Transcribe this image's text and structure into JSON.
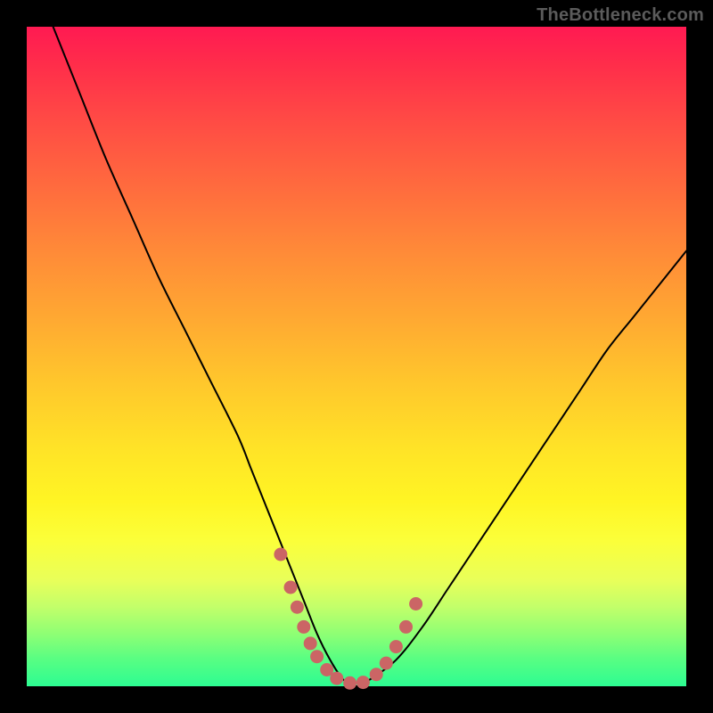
{
  "watermark": "TheBottleneck.com",
  "colors": {
    "frame_background": "#000000",
    "watermark_text": "#5b5b5b",
    "curve_stroke": "#000000",
    "marker_fill": "#cb6565",
    "gradient_stops": [
      "#ff1a52",
      "#ff2e4a",
      "#ff4a45",
      "#ff6a3e",
      "#ff8a38",
      "#ffa832",
      "#ffc72c",
      "#ffe327",
      "#fff524",
      "#fbff3a",
      "#e8ff5a",
      "#c2ff6a",
      "#8fff74",
      "#57fe83",
      "#2dfc92"
    ]
  },
  "chart_data": {
    "type": "line",
    "title": "",
    "xlabel": "",
    "ylabel": "",
    "xlim": [
      0,
      100
    ],
    "ylim": [
      0,
      100
    ],
    "note": "x is normalized horizontal position (0-100 left→right); y is normalized penalty metric (0 at bottom = optimal / green, 100 at top = worst / red). No axis ticks or numeric labels are rendered.",
    "series": [
      {
        "name": "bottleneck-curve",
        "x": [
          0,
          4,
          8,
          12,
          16,
          20,
          24,
          28,
          32,
          34,
          36,
          38,
          40,
          42,
          44,
          46,
          48,
          50,
          52,
          56,
          60,
          64,
          68,
          72,
          76,
          80,
          84,
          88,
          92,
          96,
          100
        ],
        "y": [
          110,
          100,
          90,
          80,
          71,
          62,
          54,
          46,
          38,
          33,
          28,
          23,
          18,
          13,
          8,
          4,
          1,
          0,
          1,
          4,
          9,
          15,
          21,
          27,
          33,
          39,
          45,
          51,
          56,
          61,
          66
        ]
      }
    ],
    "markers": {
      "name": "highlight-dots",
      "points": [
        {
          "x": 38.5,
          "y": 20
        },
        {
          "x": 40,
          "y": 15
        },
        {
          "x": 41,
          "y": 12
        },
        {
          "x": 42,
          "y": 9
        },
        {
          "x": 43,
          "y": 6.5
        },
        {
          "x": 44,
          "y": 4.5
        },
        {
          "x": 45.5,
          "y": 2.5
        },
        {
          "x": 47,
          "y": 1.2
        },
        {
          "x": 49,
          "y": 0.5
        },
        {
          "x": 51,
          "y": 0.6
        },
        {
          "x": 53,
          "y": 1.8
        },
        {
          "x": 54.5,
          "y": 3.5
        },
        {
          "x": 56,
          "y": 6
        },
        {
          "x": 57.5,
          "y": 9
        },
        {
          "x": 59,
          "y": 12.5
        }
      ]
    }
  }
}
